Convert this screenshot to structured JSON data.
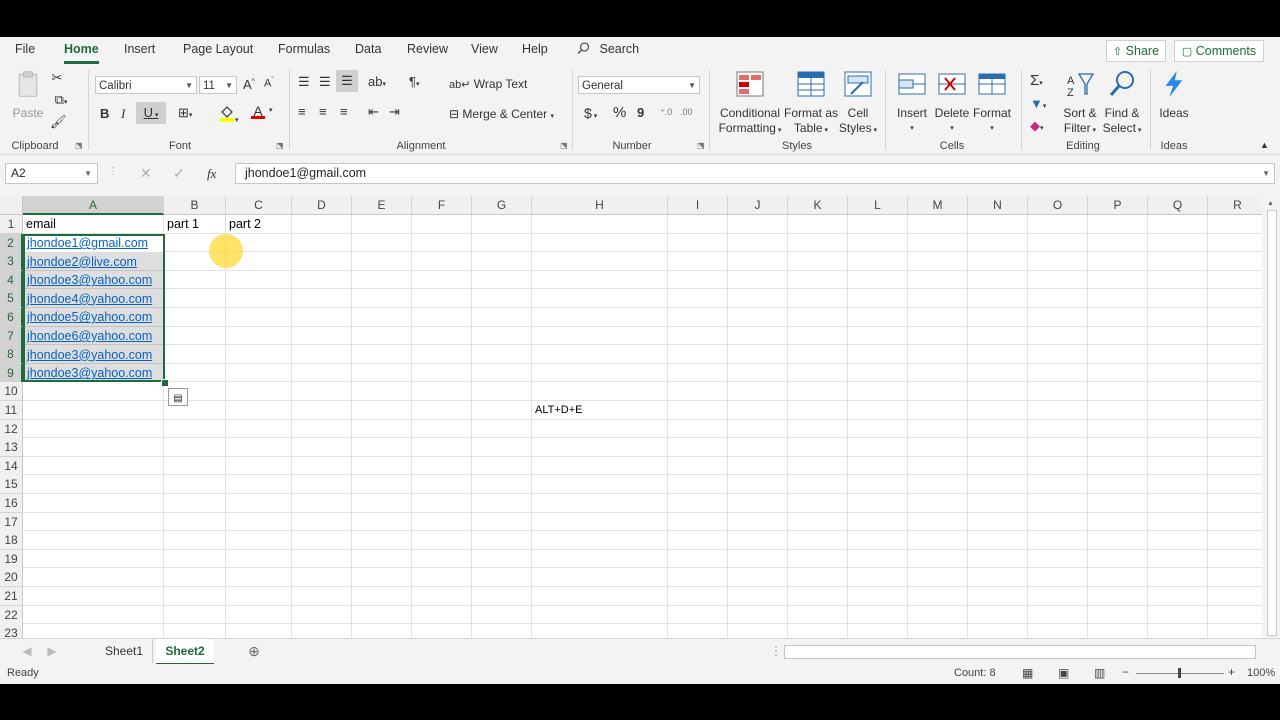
{
  "menu": {
    "tabs": [
      "File",
      "Home",
      "Insert",
      "Page Layout",
      "Formulas",
      "Data",
      "Review",
      "View",
      "Help"
    ],
    "active_tab": "Home",
    "search_label": "Search",
    "share_label": "Share",
    "comments_label": "Comments"
  },
  "ribbon": {
    "clipboard": {
      "paste_label": "Paste",
      "group_label": "Clipboard"
    },
    "font": {
      "font_name": "Calibri",
      "font_size": "11",
      "group_label": "Font",
      "bold": "B",
      "italic": "I",
      "underline": "U"
    },
    "alignment": {
      "wrap_text": "Wrap Text",
      "merge_center": "Merge & Center",
      "group_label": "Alignment"
    },
    "number": {
      "format": "General",
      "group_label": "Number",
      "currency": "$",
      "percent": "%",
      "comma": "9"
    },
    "styles": {
      "conditional_formatting": [
        "Conditional",
        "Formatting"
      ],
      "format_as_table": [
        "Format as",
        "Table"
      ],
      "cell_styles": [
        "Cell",
        "Styles"
      ],
      "group_label": "Styles"
    },
    "cells": {
      "insert": "Insert",
      "delete": "Delete",
      "format": "Format",
      "group_label": "Cells"
    },
    "editing": {
      "sort_filter": [
        "Sort &",
        "Filter"
      ],
      "find_select": [
        "Find &",
        "Select"
      ],
      "group_label": "Editing"
    },
    "ideas": {
      "label": "Ideas",
      "group_label": "Ideas"
    }
  },
  "formula_bar": {
    "name_box": "A2",
    "fx": "fx",
    "content": "jhondoe1@gmail.com"
  },
  "sheet": {
    "columns": [
      "A",
      "B",
      "C",
      "D",
      "E",
      "F",
      "G",
      "H",
      "I",
      "J",
      "K",
      "L",
      "M",
      "N",
      "O",
      "P",
      "Q",
      "R"
    ],
    "rows": [
      "1",
      "2",
      "3",
      "4",
      "5",
      "6",
      "7",
      "8",
      "9",
      "10",
      "11",
      "12",
      "13",
      "14",
      "15",
      "16",
      "17",
      "18",
      "19",
      "20",
      "21",
      "22",
      "23"
    ],
    "header_row": {
      "a1": "email",
      "b1": "part 1",
      "c1": "part 2"
    },
    "emails": [
      "jhondoe1@gmail.com",
      "jhondoe2@live.com",
      "jhondoe3@yahoo.com",
      "jhondoe4@yahoo.com",
      "jhondoe5@yahoo.com",
      "jhondoe6@yahoo.com",
      "jhondoe3@yahoo.com",
      "jhondoe3@yahoo.com"
    ],
    "note_cell_h11": "ALT+D+E"
  },
  "sheet_tabs": {
    "tabs": [
      "Sheet1",
      "Sheet2"
    ],
    "active": "Sheet2"
  },
  "status_bar": {
    "ready": "Ready",
    "count": "Count: 8",
    "zoom": "100%"
  },
  "colors": {
    "accent": "#1e6b3e",
    "link": "#0563c1"
  }
}
